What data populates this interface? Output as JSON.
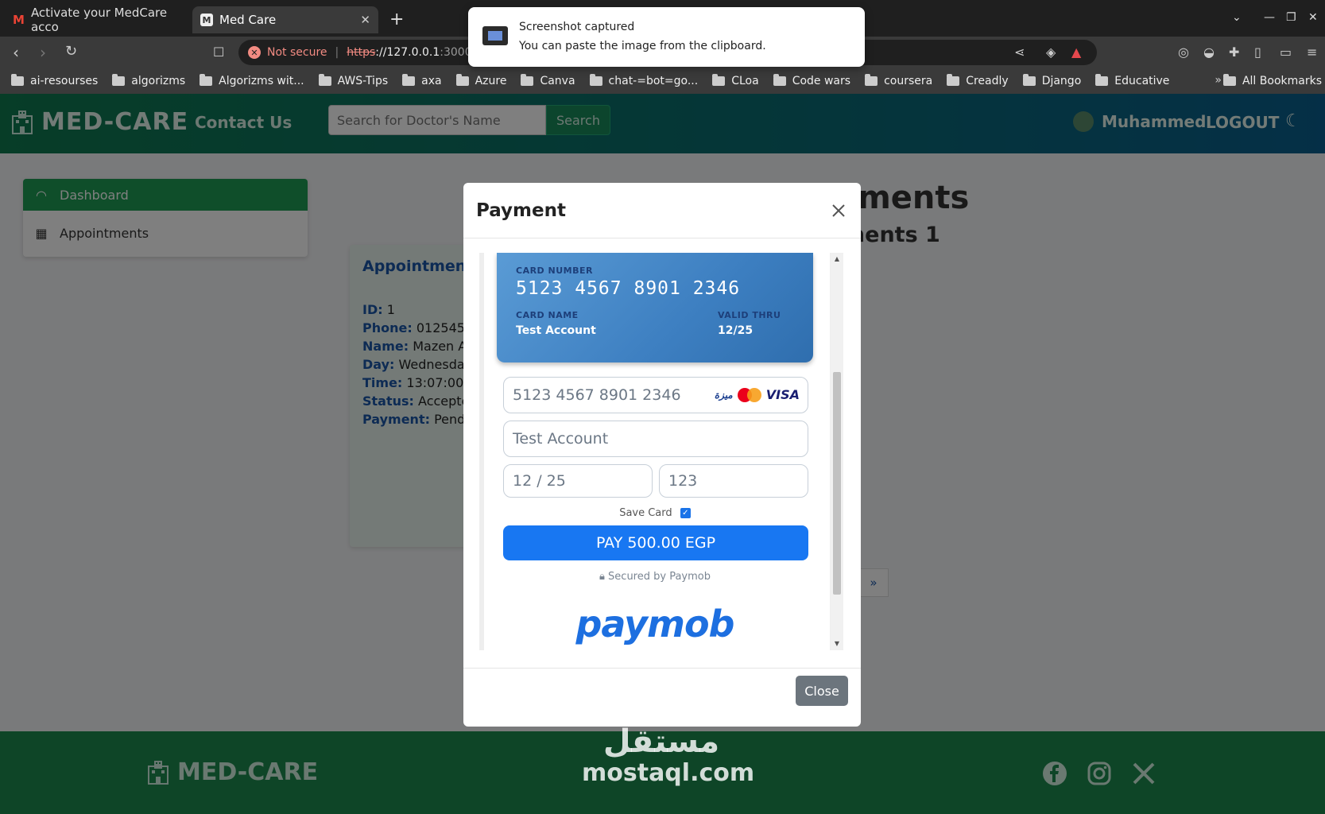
{
  "browser": {
    "tabs": [
      {
        "label": "Activate your MedCare acco"
      },
      {
        "label": "Med Care"
      }
    ],
    "url": {
      "security_label": "Not secure",
      "scheme": "https",
      "host": "://127.0.0.1",
      "path": ":3000/App"
    },
    "bookmarks": [
      "ai-resourses",
      "algorizms",
      "Algorizms wit...",
      "AWS-Tips",
      "axa",
      "Azure",
      "Canva",
      "chat-=bot=go...",
      "CLoa",
      "Code wars",
      "coursera",
      "Creadly",
      "Django",
      "Educative"
    ],
    "all_bookmarks": "All Bookmarks"
  },
  "notification": {
    "title": "Screenshot captured",
    "text": "You can paste the image from the clipboard."
  },
  "site": {
    "brand": "MED-CARE",
    "contact": "Contact Us",
    "search_placeholder": "Search for Doctor's Name",
    "search_button": "Search",
    "user_name": "Muhammed",
    "logout": "LOGOUT"
  },
  "sidebar": {
    "items": [
      {
        "label": "Dashboard"
      },
      {
        "label": "Appointments"
      }
    ]
  },
  "background": {
    "title": "tments",
    "subtitle": "ments 1",
    "card_title": "Appointment",
    "rows": [
      {
        "label": "ID:",
        "value": "1"
      },
      {
        "label": "Phone:",
        "value": "0125454"
      },
      {
        "label": "Name:",
        "value": "Mazen Ah"
      },
      {
        "label": "Day:",
        "value": "Wednesday"
      },
      {
        "label": "Time:",
        "value": "13:07:00 - 1"
      },
      {
        "label": "Status:",
        "value": "Accepted"
      },
      {
        "label": "Payment:",
        "value": "Pendin"
      }
    ],
    "pager_next": "»"
  },
  "modal": {
    "title": "Payment",
    "card_preview": {
      "number_label": "CARD NUMBER",
      "number": "5123  4567  8901  2346",
      "name_label": "CARD NAME",
      "name": "Test Account",
      "valid_label": "VALID THRU",
      "valid": "12/25"
    },
    "fields": {
      "card_number": "5123 4567 8901 2346",
      "card_name": "Test Account",
      "expiry": "12 / 25",
      "cvv": "123"
    },
    "brands": {
      "meeza": "ميزة",
      "visa": "VISA"
    },
    "save_card": "Save Card",
    "save_card_checked": true,
    "pay_button": "PAY 500.00 EGP",
    "secured": "Secured by Paymob",
    "paymob_logo": "paymob",
    "close_button": "Close"
  },
  "footer": {
    "brand": "MED-CARE"
  },
  "watermark": {
    "arabic": "مستقل",
    "latin": "mostaql.com"
  },
  "colors": {
    "header_gradient_start": "#0f7a4f",
    "header_gradient_end": "#0b5f8e",
    "sidebar_active": "#1f9d55",
    "pay_button": "#1877f2",
    "close_button": "#6c757d",
    "footer": "#1c8a4f"
  }
}
